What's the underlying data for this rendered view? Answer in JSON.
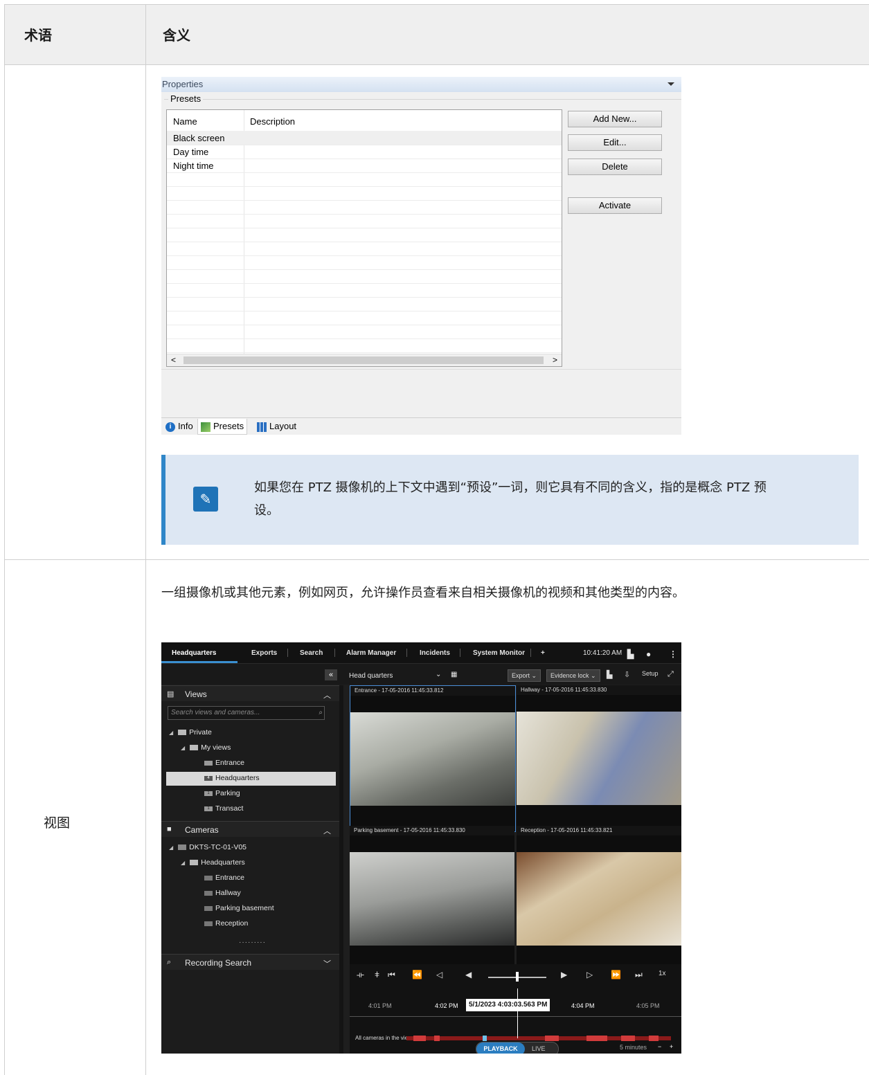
{
  "table": {
    "header": {
      "term": "术语",
      "meaning": "含义"
    },
    "row2_term": "视图",
    "row2_desc": "一组摄像机或其他元素，例如网页，允许操作员查看来自相关摄像机的视频和其他类型的内容。"
  },
  "properties": {
    "title": "Properties",
    "group": "Presets",
    "columns": [
      "Name",
      "Description"
    ],
    "rows": [
      "Black screen",
      "Day time",
      "Night time"
    ],
    "buttons": [
      "Add New...",
      "Edit...",
      "Delete",
      "Activate"
    ],
    "tabs": [
      "Info",
      "Presets",
      "Layout"
    ]
  },
  "note": {
    "text": "如果您在 PTZ 摄像机的上下文中遇到“预设”一词，则它具有不同的含义，指的是概念 PTZ 预设。"
  },
  "client": {
    "tabs": [
      "Headquarters",
      "Exports",
      "Search",
      "Alarm Manager",
      "Incidents",
      "System Monitor",
      "+"
    ],
    "clock": "10:41:20 AM",
    "view_select": "Head quarters",
    "export_btn": "Export",
    "evidence_btn": "Evidence lock",
    "setup": "Setup",
    "views_title": "Views",
    "search_placeholder": "Search views and cameras...",
    "tree": {
      "private": "Private",
      "my_views": "My views",
      "entrance": "Entrance",
      "headquarters": "Headquarters",
      "parking": "Parking",
      "transact": "Transact"
    },
    "cameras_title": "Cameras",
    "server": "DKTS-TC-01-V05",
    "cam_folder": "Headquarters",
    "cams": [
      "Entrance",
      "Hallway",
      "Parking basement",
      "Reception"
    ],
    "dots": "·········",
    "recording_search": "Recording Search",
    "tiles": [
      "Entrance - 17-05-2016 11:45:33.812",
      "Hallway - 17-05-2016 11:45:33.830",
      "Parking basement - 17-05-2016 11:45:33.830",
      "Reception - 17-05-2016 11:45:33.821"
    ],
    "speed": "1x",
    "times": [
      "4:01 PM",
      "4:02 PM",
      "4:04 PM",
      "4:05 PM"
    ],
    "current_time": "5/1/2023 4:03:03.563 PM",
    "all_cams": "All cameras in the view",
    "playback": "PLAYBACK",
    "live": "LIVE",
    "span": "5 minutes"
  }
}
